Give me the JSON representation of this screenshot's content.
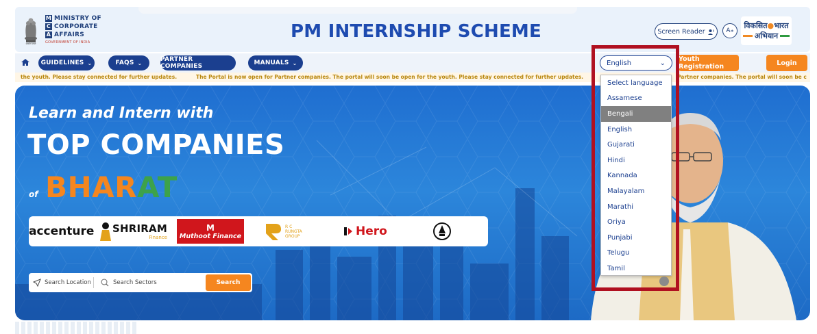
{
  "header": {
    "ministry_lines": [
      "MINISTRY OF",
      "CORPORATE",
      "AFFAIRS"
    ],
    "ministry_initials": [
      "M",
      "C",
      "A"
    ],
    "gov_india": "GOVERNMENT OF INDIA",
    "site_title": "PM INTERNSHIP SCHEME",
    "screen_reader_label": "Screen Reader",
    "a11y_label": "A",
    "viksit_line1": "विकसित",
    "viksit_line1b": "भारत",
    "viksit_line2": "अभियान"
  },
  "nav": {
    "items": [
      {
        "label": "GUIDELINES"
      },
      {
        "label": "FAQS"
      },
      {
        "label": "PARTNER COMPANIES"
      },
      {
        "label": "MANUALS"
      }
    ],
    "language_selected": "English",
    "youth_registration": "Youth Registration",
    "login": "Login"
  },
  "ticker": {
    "segments": [
      "the youth. Please stay connected for further updates.",
      "The Portal is now open for Partner companies. The portal will soon be open for the youth. Please stay connected for further updates.",
      "Partner companies. The portal will soon be c"
    ]
  },
  "hero": {
    "tagline1": "Learn and Intern with",
    "tagline2": "TOP COMPANIES",
    "of": "of",
    "bharat_orange": "BHAR",
    "bharat_green": "AT",
    "logos": {
      "accenture": "accenture",
      "shriram": "SHRIRAM",
      "shriram_sub": "Finance",
      "muthoot": "Muthoot Finance",
      "muthoot_mark": "M",
      "rc_line1": "R C",
      "rc_line2": "RUNGTA",
      "rc_line3": "GROUP",
      "hero": "Hero"
    },
    "search": {
      "location": "Search Location",
      "sectors": "Search Sectors",
      "button": "Search"
    }
  },
  "language_dropdown": {
    "options": [
      "Select language",
      "Assamese",
      "Bengali",
      "English",
      "Gujarati",
      "Hindi",
      "Kannada",
      "Malayalam",
      "Marathi",
      "Oriya",
      "Punjabi",
      "Telugu",
      "Tamil"
    ],
    "highlighted": "Bengali"
  },
  "colors": {
    "navy": "#1b3f8f",
    "orange": "#f5861f",
    "highlight_border": "#b01020"
  }
}
